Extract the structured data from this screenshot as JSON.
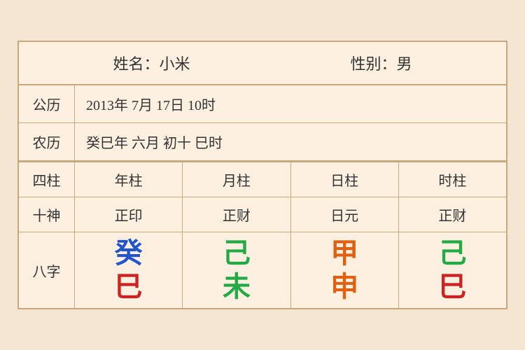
{
  "header": {
    "name_label": "姓名：小米",
    "gender_label": "性别：男"
  },
  "gregorian": {
    "label": "公历",
    "value": "2013年 7月 17日 10时"
  },
  "lunar": {
    "label": "农历",
    "value": "癸巳年 六月 初十 巳时"
  },
  "columns": {
    "header_label": "四柱",
    "cols": [
      "年柱",
      "月柱",
      "日柱",
      "时柱"
    ]
  },
  "shishen": {
    "label": "十神",
    "values": [
      "正印",
      "正财",
      "日元",
      "正财"
    ]
  },
  "bazhi": {
    "label": "八字",
    "chars": [
      {
        "top": "癸",
        "bottom": "巳",
        "top_color": "blue",
        "bottom_color": "red"
      },
      {
        "top": "己",
        "bottom": "未",
        "top_color": "green",
        "bottom_color": "green"
      },
      {
        "top": "甲",
        "bottom": "申",
        "top_color": "orange",
        "bottom_color": "orange"
      },
      {
        "top": "己",
        "bottom": "巳",
        "top_color": "green2",
        "bottom_color": "red"
      }
    ]
  }
}
